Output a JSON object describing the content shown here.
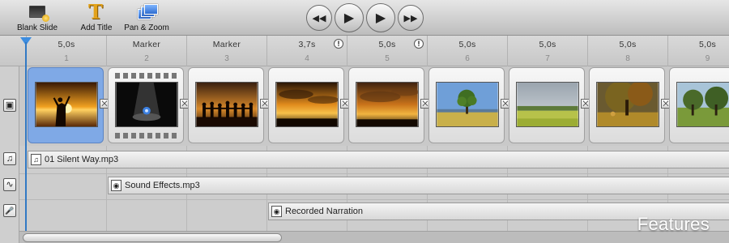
{
  "toolbar": {
    "blank_slide": "Blank Slide",
    "add_title": "Add Title",
    "pan_zoom": "Pan & Zoom"
  },
  "transport": {
    "rewind": "◀◀",
    "play": "▶",
    "play_alt": "▶",
    "forward": "▶▶"
  },
  "ruler": [
    {
      "duration": "5,0s",
      "number": "1",
      "warning": ""
    },
    {
      "duration": "Marker",
      "number": "2",
      "warning": ""
    },
    {
      "duration": "Marker",
      "number": "3",
      "warning": ""
    },
    {
      "duration": "3,7s",
      "number": "4",
      "warning": "!"
    },
    {
      "duration": "5,0s",
      "number": "5",
      "warning": "!"
    },
    {
      "duration": "5,0s",
      "number": "6",
      "warning": ""
    },
    {
      "duration": "5,0s",
      "number": "7",
      "warning": ""
    },
    {
      "duration": "5,0s",
      "number": "8",
      "warning": ""
    },
    {
      "duration": "5,0s",
      "number": "9",
      "warning": ""
    }
  ],
  "slides": [
    {
      "scene": "sunset-silhouette",
      "selected": true
    },
    {
      "scene": "spotlight-logo",
      "selected": false
    },
    {
      "scene": "people-sunset",
      "selected": false
    },
    {
      "scene": "sunset-clouds",
      "selected": false
    },
    {
      "scene": "sunset-clouds-2",
      "selected": false
    },
    {
      "scene": "tree-field",
      "selected": false
    },
    {
      "scene": "grass-field",
      "selected": false
    },
    {
      "scene": "autumn-tree",
      "selected": false
    },
    {
      "scene": "olive-trees",
      "selected": false
    }
  ],
  "gutter": {
    "slides_icon": "▣",
    "music_icon": "♫",
    "sound_icon": "∿",
    "mic_icon": "🎤"
  },
  "audio": {
    "music": "01 Silent Way.mp3",
    "effects": "Sound Effects.mp3",
    "narration": "Recorded Narration"
  },
  "caption": "Features",
  "colors": {
    "selection": "#7fa9e6",
    "playhead": "#3179c4"
  }
}
